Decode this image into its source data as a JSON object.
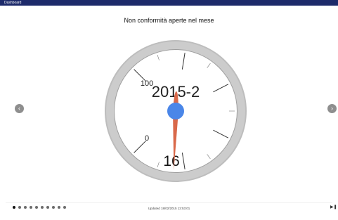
{
  "window": {
    "title": "Dashboard"
  },
  "chart_data": {
    "type": "gauge",
    "title": "Non conformità aperte nel mese",
    "label": "2015-2",
    "value": 16,
    "value_text": "16",
    "min": 0,
    "max": 100,
    "tick_labels": [
      "0",
      "100"
    ],
    "colors": {
      "needle": "#d9694a",
      "hub": "#4a86e8",
      "bezel": "#cccccc",
      "face": "#ffffff"
    }
  },
  "navigation": {
    "prev_icon": "chevron-left-icon",
    "next_icon": "chevron-right-icon",
    "prev_glyph": "‹",
    "next_glyph": "›",
    "page_count": 10,
    "active_page": 1
  },
  "footer": {
    "updated_text": "Updated 18/02/2015 12:53:01",
    "play_glyph": "▶",
    "pause_glyph": "❚❚"
  }
}
